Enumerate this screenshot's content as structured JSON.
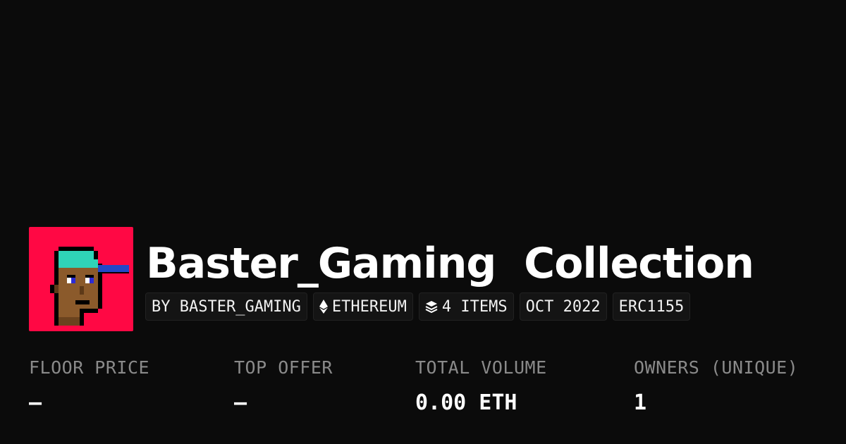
{
  "collection": {
    "title": "Baster_Gaming  Collection",
    "avatar_icon": "pixel-punk-avatar-icon",
    "avatar_bg": "#ff0844"
  },
  "pills": {
    "creator": "BY BASTER_GAMING",
    "chain": "ETHEREUM",
    "chain_icon": "ethereum-icon",
    "items": "4 ITEMS",
    "items_icon": "layers-icon",
    "date": "OCT 2022",
    "standard": "ERC1155"
  },
  "stats": {
    "floor_price": {
      "label": "FLOOR PRICE",
      "value": "—"
    },
    "top_offer": {
      "label": "TOP OFFER",
      "value": "—"
    },
    "total_volume": {
      "label": "TOTAL VOLUME",
      "value": "0.00 ETH"
    },
    "owners": {
      "label": "OWNERS (UNIQUE)",
      "value": "1"
    }
  },
  "colors": {
    "background": "#0a0a0a",
    "text": "#ffffff",
    "muted": "#8a8a8a",
    "pill_bg": "#141414"
  }
}
